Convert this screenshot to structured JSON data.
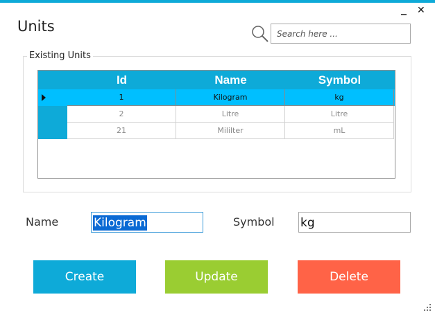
{
  "window": {
    "title": "Units",
    "minimize_glyph": "_",
    "close_glyph": "✕",
    "accent_color": "#0eaad8"
  },
  "search": {
    "placeholder": "Search here ...",
    "value": "",
    "icon": "search-icon"
  },
  "existing_units": {
    "legend": "Existing Units",
    "columns": [
      "Id",
      "Name",
      "Symbol"
    ],
    "rows": [
      {
        "id": "1",
        "name": "Kilogram",
        "symbol": "kg",
        "selected": true
      },
      {
        "id": "2",
        "name": "Litre",
        "symbol": "Litre",
        "selected": false
      },
      {
        "id": "21",
        "name": "Mililter",
        "symbol": "mL",
        "selected": false
      }
    ],
    "selected_row_color": "#00bfff"
  },
  "form": {
    "name_label": "Name",
    "name_value": "Kilogram",
    "symbol_label": "Symbol",
    "symbol_value": "kg"
  },
  "actions": {
    "create_label": "Create",
    "update_label": "Update",
    "delete_label": "Delete",
    "create_color": "#0eaad8",
    "update_color": "#9acd32",
    "delete_color": "#ff6347"
  }
}
